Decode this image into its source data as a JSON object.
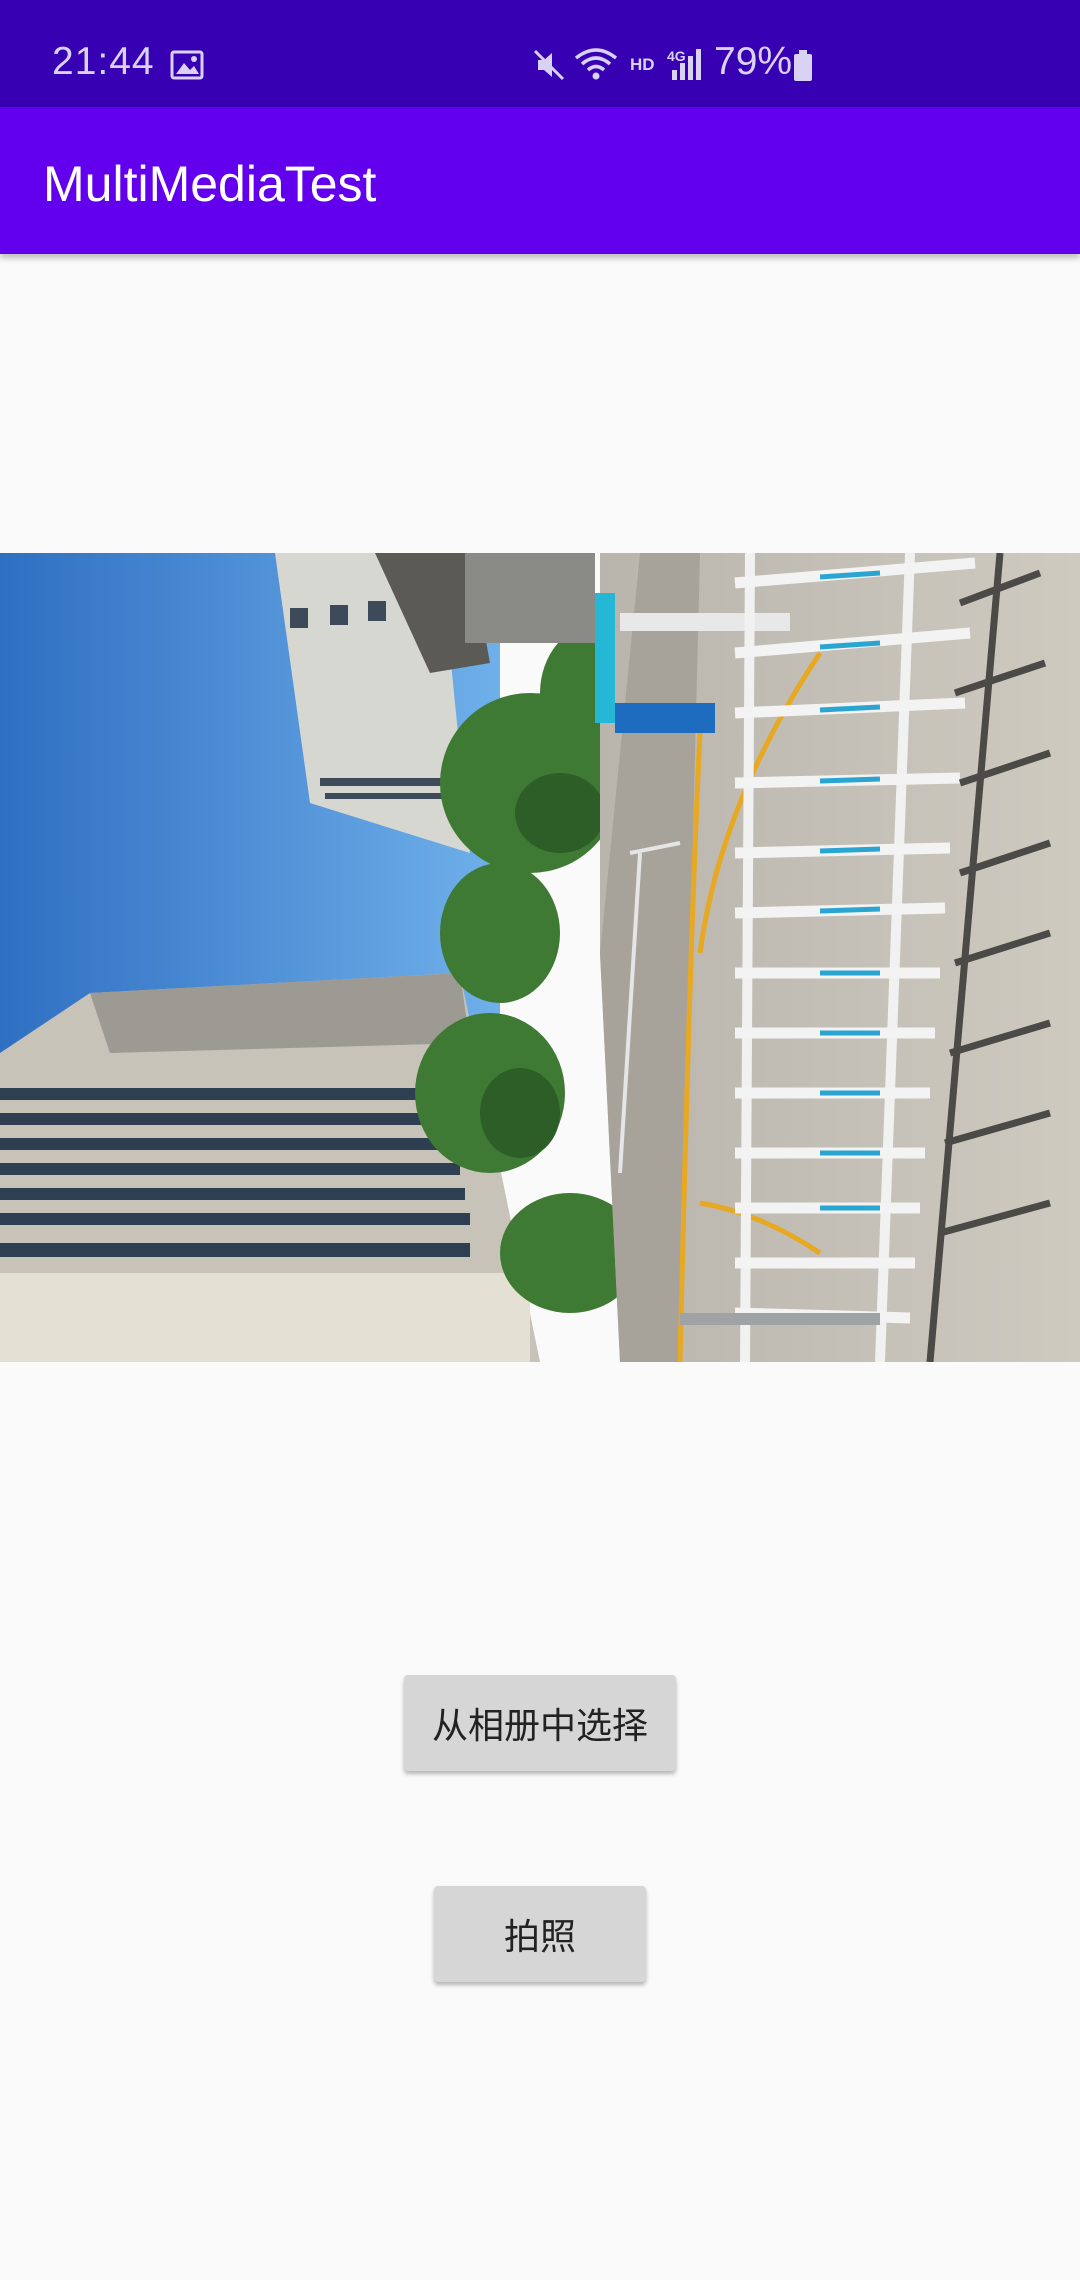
{
  "status_bar": {
    "time": "21:44",
    "hd": "HD",
    "network": "4G",
    "battery_percent": "79%",
    "icons": [
      "gallery-icon",
      "mute-icon",
      "wifi-icon",
      "signal-icon",
      "battery-icon"
    ]
  },
  "app_bar": {
    "title": "MultiMediaTest",
    "color": "#6200ee"
  },
  "photo": {
    "description_icon": "photo-image"
  },
  "buttons": {
    "choose_from_album": "从相册中选择",
    "take_photo": "拍照"
  },
  "colors": {
    "status_bar": "#3700b3",
    "app_bar": "#6200ee",
    "background": "#fafafa",
    "button": "#d6d6d6"
  }
}
